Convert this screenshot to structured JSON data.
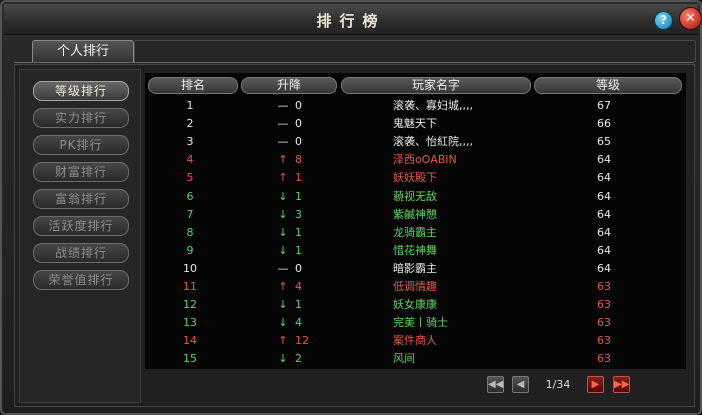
{
  "window": {
    "title": "排行榜",
    "help_label": "?",
    "close_label": "✕"
  },
  "tabs": [
    {
      "label": "个人排行",
      "active": true
    }
  ],
  "categories": [
    {
      "label": "等级排行",
      "active": true
    },
    {
      "label": "实力排行",
      "active": false
    },
    {
      "label": "PK排行",
      "active": false
    },
    {
      "label": "财富排行",
      "active": false
    },
    {
      "label": "富翁排行",
      "active": false
    },
    {
      "label": "活跃度排行",
      "active": false
    },
    {
      "label": "战绩排行",
      "active": false
    },
    {
      "label": "荣誉值排行",
      "active": false
    }
  ],
  "table": {
    "headers": {
      "rank": "排名",
      "change": "升降",
      "name": "玩家名字",
      "level": "等级"
    },
    "rows": [
      {
        "rank": "1",
        "arrow": "—",
        "delta": "0",
        "name": "滚袭、寡妇城,,,,",
        "level": "67",
        "status": "same"
      },
      {
        "rank": "2",
        "arrow": "—",
        "delta": "0",
        "name": "鬼魅天下",
        "level": "66",
        "status": "same"
      },
      {
        "rank": "3",
        "arrow": "—",
        "delta": "0",
        "name": "滚袭、怡紅院,,,,",
        "level": "65",
        "status": "same"
      },
      {
        "rank": "4",
        "arrow": "↑",
        "delta": "8",
        "name": "泽西oOABIN",
        "level": "64",
        "status": "up"
      },
      {
        "rank": "5",
        "arrow": "↑",
        "delta": "1",
        "name": "妖妖殿下",
        "level": "64",
        "status": "up"
      },
      {
        "rank": "6",
        "arrow": "↓",
        "delta": "1",
        "name": "藐视无敌",
        "level": "64",
        "status": "down"
      },
      {
        "rank": "7",
        "arrow": "↓",
        "delta": "3",
        "name": "紫鹹神憩",
        "level": "64",
        "status": "down"
      },
      {
        "rank": "8",
        "arrow": "↓",
        "delta": "1",
        "name": "龙骑霸主",
        "level": "64",
        "status": "down"
      },
      {
        "rank": "9",
        "arrow": "↓",
        "delta": "1",
        "name": "惜花神舞",
        "level": "64",
        "status": "down"
      },
      {
        "rank": "10",
        "arrow": "—",
        "delta": "0",
        "name": "暗影霸主",
        "level": "64",
        "status": "same"
      },
      {
        "rank": "11",
        "arrow": "↑",
        "delta": "4",
        "name": "低调情趣",
        "level": "63",
        "status": "up"
      },
      {
        "rank": "12",
        "arrow": "↓",
        "delta": "1",
        "name": "妖女康康",
        "level": "63",
        "status": "down"
      },
      {
        "rank": "13",
        "arrow": "↓",
        "delta": "4",
        "name": "完美丨骑士",
        "level": "63",
        "status": "down"
      },
      {
        "rank": "14",
        "arrow": "↑",
        "delta": "12",
        "name": "案件商人",
        "level": "63",
        "status": "up"
      },
      {
        "rank": "15",
        "arrow": "↓",
        "delta": "2",
        "name": "风间",
        "level": "63",
        "status": "down"
      }
    ]
  },
  "pagination": {
    "page_text": "1/34",
    "first": "◀◀",
    "prev": "◀",
    "next": "▶",
    "last": "▶▶"
  },
  "colors": {
    "same": "#e8e8e8",
    "up": "#e25a48",
    "down": "#5fd35f",
    "level_normal": "#e8e8e8",
    "level_red": "#e25a48"
  }
}
